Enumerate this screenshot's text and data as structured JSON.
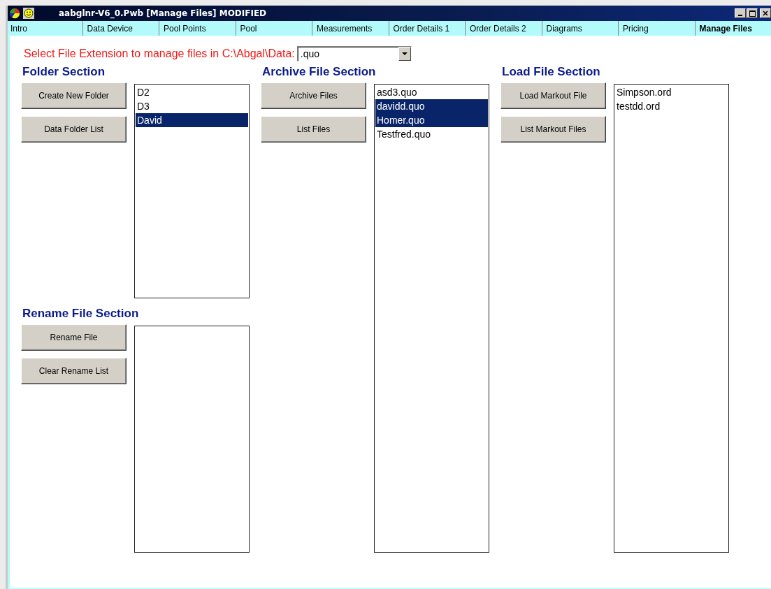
{
  "window": {
    "title": "aabglnr-V6_0.Pwb [Manage Files] MODIFIED"
  },
  "tabs": [
    {
      "label": "Intro",
      "selected": false
    },
    {
      "label": "Data Device",
      "selected": false
    },
    {
      "label": "Pool Points",
      "selected": false
    },
    {
      "label": "Pool",
      "selected": false
    },
    {
      "label": "Measurements",
      "selected": false
    },
    {
      "label": "Order Details 1",
      "selected": false
    },
    {
      "label": "Order Details 2",
      "selected": false
    },
    {
      "label": "Diagrams",
      "selected": false
    },
    {
      "label": "Pricing",
      "selected": false
    },
    {
      "label": "Manage Files",
      "selected": true
    }
  ],
  "extension": {
    "label": "Select File Extension to manage files in C:\\Abgal\\Data:",
    "value": ".quo"
  },
  "columns": [
    {
      "sections": [
        {
          "title": "Folder Section",
          "buttons": [
            "Create New Folder",
            "Data Folder List"
          ],
          "items": [
            {
              "text": "D2",
              "selected": false
            },
            {
              "text": "D3",
              "selected": false
            },
            {
              "text": "David",
              "selected": true
            }
          ]
        },
        {
          "title": "Rename File Section",
          "buttons": [
            "Rename File",
            "Clear Rename List"
          ]
        }
      ]
    },
    {
      "sections": [
        {
          "title": "Archive File Section",
          "buttons": [
            "Archive Files",
            "List Files"
          ],
          "items": [
            {
              "text": "asd3.quo",
              "selected": false
            },
            {
              "text": "davidd.quo",
              "selected": true
            },
            {
              "text": "Homer.quo",
              "selected": true
            },
            {
              "text": "Testfred.quo",
              "selected": false
            }
          ]
        }
      ]
    },
    {
      "sections": [
        {
          "title": "Load File Section",
          "buttons": [
            "Load Markout File",
            "List Markout Files"
          ],
          "items": [
            {
              "text": "Simpson.ord",
              "selected": false
            },
            {
              "text": "testdd.ord",
              "selected": false
            }
          ]
        }
      ]
    }
  ]
}
